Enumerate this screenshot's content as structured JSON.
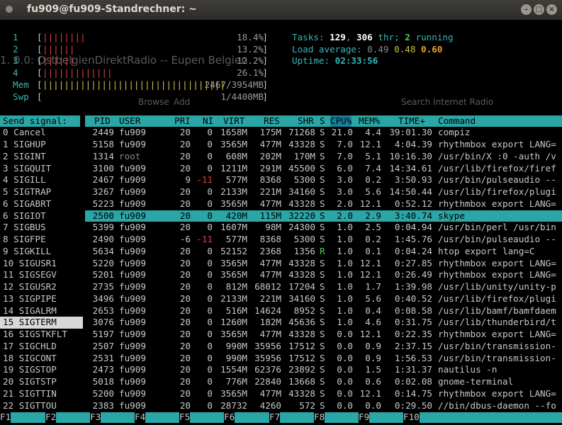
{
  "window": {
    "title": "fu909@fu909-Standrechner: ~"
  },
  "meters": {
    "cpus": [
      {
        "label": "1",
        "bars": "||||||||",
        "value": "18.4%"
      },
      {
        "label": "2",
        "bars": "||||||",
        "value": "13.2%"
      },
      {
        "label": "3",
        "bars": "||||||",
        "value": "12.2%"
      },
      {
        "label": "4",
        "bars": "|||||||||||||",
        "value": "26.1%"
      }
    ],
    "mem": {
      "label": "Mem",
      "bars": "||||||||||||||||||||||||||||||||||",
      "value": "2467/3954MB"
    },
    "swp": {
      "label": "Swp",
      "bars": "",
      "value": "1/4400MB"
    }
  },
  "summary": {
    "tasks_label": "Tasks:",
    "tasks": "129",
    "thr": "306",
    "thr_label": "thr;",
    "running": "2",
    "running_label": "running",
    "load_label": "Load average:",
    "load1": "0.49",
    "load5": "0.48",
    "load15": "0.60",
    "uptime_label": "Uptime:",
    "uptime": "02:33:56"
  },
  "signals": {
    "header": "Send signal:",
    "items": [
      "0 Cancel",
      "1 SIGHUP",
      "2 SIGINT",
      "3 SIGQUIT",
      "4 SIGILL",
      "5 SIGTRAP",
      "6 SIGABRT",
      "6 SIGIOT",
      "7 SIGBUS",
      "8 SIGFPE",
      "9 SIGKILL",
      "10 SIGUSR1",
      "11 SIGSEGV",
      "12 SIGUSR2",
      "13 SIGPIPE",
      "14 SIGALRM",
      "15 SIGTERM",
      "16 SIGSTKFLT",
      "17 SIGCHLD",
      "18 SIGCONT",
      "19 SIGSTOP",
      "20 SIGTSTP",
      "21 SIGTTIN",
      "22 SIGTTOU"
    ],
    "selected": 16
  },
  "columns": [
    "PID",
    "USER",
    "PRI",
    "NI",
    "VIRT",
    "RES",
    "SHR",
    "S",
    "CPU%",
    "MEM%",
    "TIME+",
    "Command"
  ],
  "processes": [
    {
      "pid": "2449",
      "user": "fu909",
      "pri": "20",
      "ni": "0",
      "virt": "1658M",
      "res": "175M",
      "shr": "71268",
      "s": "S",
      "cpu": "21.0",
      "mem": "4.4",
      "time": "39:01.30",
      "cmd": "compiz"
    },
    {
      "pid": "5158",
      "user": "fu909",
      "pri": "20",
      "ni": "0",
      "virt": "3565M",
      "res": "477M",
      "shr": "43328",
      "s": "S",
      "cpu": "7.0",
      "mem": "12.1",
      "time": "4:04.39",
      "cmd": "rhythmbox export LANG="
    },
    {
      "pid": "1314",
      "user": "root",
      "pri": "20",
      "ni": "0",
      "virt": "608M",
      "res": "202M",
      "shr": "170M",
      "s": "S",
      "cpu": "7.0",
      "mem": "5.1",
      "time": "10:16.30",
      "cmd": "/usr/bin/X :0 -auth /v"
    },
    {
      "pid": "3100",
      "user": "fu909",
      "pri": "20",
      "ni": "0",
      "virt": "1211M",
      "res": "291M",
      "shr": "45500",
      "s": "S",
      "cpu": "6.0",
      "mem": "7.4",
      "time": "14:34.61",
      "cmd": "/usr/lib/firefox/firef"
    },
    {
      "pid": "2467",
      "user": "fu909",
      "pri": "9",
      "ni": "-11",
      "virt": "577M",
      "res": "8368",
      "shr": "5300",
      "s": "S",
      "cpu": "3.0",
      "mem": "0.2",
      "time": "3:50.93",
      "cmd": "/usr/bin/pulseaudio --"
    },
    {
      "pid": "3267",
      "user": "fu909",
      "pri": "20",
      "ni": "0",
      "virt": "2133M",
      "res": "221M",
      "shr": "34160",
      "s": "S",
      "cpu": "3.0",
      "mem": "5.6",
      "time": "14:50.44",
      "cmd": "/usr/lib/firefox/plugi"
    },
    {
      "pid": "5223",
      "user": "fu909",
      "pri": "20",
      "ni": "0",
      "virt": "3565M",
      "res": "477M",
      "shr": "43328",
      "s": "S",
      "cpu": "2.0",
      "mem": "12.1",
      "time": "0:52.12",
      "cmd": "rhythmbox export LANG="
    },
    {
      "pid": "2500",
      "user": "fu909",
      "pri": "20",
      "ni": "0",
      "virt": "420M",
      "res": "115M",
      "shr": "32220",
      "s": "S",
      "cpu": "2.0",
      "mem": "2.9",
      "time": "3:40.74",
      "cmd": "skype"
    },
    {
      "pid": "5399",
      "user": "fu909",
      "pri": "20",
      "ni": "0",
      "virt": "1607M",
      "res": "98M",
      "shr": "24300",
      "s": "S",
      "cpu": "1.0",
      "mem": "2.5",
      "time": "0:04.94",
      "cmd": "/usr/bin/perl /usr/bin"
    },
    {
      "pid": "2490",
      "user": "fu909",
      "pri": "-6",
      "ni": "-11",
      "virt": "577M",
      "res": "8368",
      "shr": "5300",
      "s": "S",
      "cpu": "1.0",
      "mem": "0.2",
      "time": "1:45.76",
      "cmd": "/usr/bin/pulseaudio --"
    },
    {
      "pid": "5634",
      "user": "fu909",
      "pri": "20",
      "ni": "0",
      "virt": "52152",
      "res": "2368",
      "shr": "1356",
      "s": "R",
      "cpu": "1.0",
      "mem": "0.1",
      "time": "0:04.24",
      "cmd": "htop export lang=C"
    },
    {
      "pid": "5220",
      "user": "fu909",
      "pri": "20",
      "ni": "0",
      "virt": "3565M",
      "res": "477M",
      "shr": "43328",
      "s": "S",
      "cpu": "1.0",
      "mem": "12.1",
      "time": "0:27.85",
      "cmd": "rhythmbox export LANG="
    },
    {
      "pid": "5201",
      "user": "fu909",
      "pri": "20",
      "ni": "0",
      "virt": "3565M",
      "res": "477M",
      "shr": "43328",
      "s": "S",
      "cpu": "1.0",
      "mem": "12.1",
      "time": "0:26.49",
      "cmd": "rhythmbox export LANG="
    },
    {
      "pid": "2735",
      "user": "fu909",
      "pri": "20",
      "ni": "0",
      "virt": "812M",
      "res": "68012",
      "shr": "17204",
      "s": "S",
      "cpu": "1.0",
      "mem": "1.7",
      "time": "1:39.98",
      "cmd": "/usr/lib/unity/unity-p"
    },
    {
      "pid": "3496",
      "user": "fu909",
      "pri": "20",
      "ni": "0",
      "virt": "2133M",
      "res": "221M",
      "shr": "34160",
      "s": "S",
      "cpu": "1.0",
      "mem": "5.6",
      "time": "0:40.52",
      "cmd": "/usr/lib/firefox/plugi"
    },
    {
      "pid": "2653",
      "user": "fu909",
      "pri": "20",
      "ni": "0",
      "virt": "516M",
      "res": "14624",
      "shr": "8952",
      "s": "S",
      "cpu": "1.0",
      "mem": "0.4",
      "time": "0:08.58",
      "cmd": "/usr/lib/bamf/bamfdaem"
    },
    {
      "pid": "3076",
      "user": "fu909",
      "pri": "20",
      "ni": "0",
      "virt": "1260M",
      "res": "182M",
      "shr": "45636",
      "s": "S",
      "cpu": "1.0",
      "mem": "4.6",
      "time": "0:31.75",
      "cmd": "/usr/lib/thunderbird/t"
    },
    {
      "pid": "5197",
      "user": "fu909",
      "pri": "20",
      "ni": "0",
      "virt": "3565M",
      "res": "477M",
      "shr": "43328",
      "s": "S",
      "cpu": "0.0",
      "mem": "12.1",
      "time": "0:22.35",
      "cmd": "rhythmbox export LANG="
    },
    {
      "pid": "2507",
      "user": "fu909",
      "pri": "20",
      "ni": "0",
      "virt": "990M",
      "res": "35956",
      "shr": "17512",
      "s": "S",
      "cpu": "0.0",
      "mem": "0.9",
      "time": "2:37.15",
      "cmd": "/usr/bin/transmission-"
    },
    {
      "pid": "2531",
      "user": "fu909",
      "pri": "20",
      "ni": "0",
      "virt": "990M",
      "res": "35956",
      "shr": "17512",
      "s": "S",
      "cpu": "0.0",
      "mem": "0.9",
      "time": "1:56.53",
      "cmd": "/usr/bin/transmission-"
    },
    {
      "pid": "2473",
      "user": "fu909",
      "pri": "20",
      "ni": "0",
      "virt": "1554M",
      "res": "62376",
      "shr": "23892",
      "s": "S",
      "cpu": "0.0",
      "mem": "1.5",
      "time": "1:31.37",
      "cmd": "nautilus -n"
    },
    {
      "pid": "5018",
      "user": "fu909",
      "pri": "20",
      "ni": "0",
      "virt": "776M",
      "res": "22840",
      "shr": "13668",
      "s": "S",
      "cpu": "0.0",
      "mem": "0.6",
      "time": "0:02.08",
      "cmd": "gnome-terminal"
    },
    {
      "pid": "5200",
      "user": "fu909",
      "pri": "20",
      "ni": "0",
      "virt": "3565M",
      "res": "477M",
      "shr": "43328",
      "s": "S",
      "cpu": "0.0",
      "mem": "12.1",
      "time": "0:14.75",
      "cmd": "rhythmbox export LANG="
    },
    {
      "pid": "2383",
      "user": "fu909",
      "pri": "20",
      "ni": "0",
      "virt": "28732",
      "res": "4260",
      "shr": "572",
      "s": "S",
      "cpu": "0.0",
      "mem": "0.0",
      "time": "0:29.50",
      "cmd": "//bin/dbus-daemon --fo"
    }
  ],
  "selected_process": 7,
  "footer": [
    {
      "key": "F1",
      "label": ""
    },
    {
      "key": "F2",
      "label": ""
    },
    {
      "key": "F3",
      "label": ""
    },
    {
      "key": "F4",
      "label": ""
    },
    {
      "key": "F5",
      "label": ""
    },
    {
      "key": "F6",
      "label": ""
    },
    {
      "key": "F7",
      "label": ""
    },
    {
      "key": "F8",
      "label": ""
    },
    {
      "key": "F9",
      "label": ""
    },
    {
      "key": "F10",
      "label": ""
    }
  ],
  "background": {
    "radio_text": "1. 0.0: OstbelgienDirektRadio -- Eupen Belgien",
    "search_placeholder": "Search Internet Radio",
    "browse": "Browse",
    "add": "Add"
  },
  "colors": {
    "cyan": "#2aa6a6",
    "green": "#4fd14f",
    "red": "#e04040",
    "blue": "#4a6ee0",
    "yellow": "#d0c040"
  }
}
